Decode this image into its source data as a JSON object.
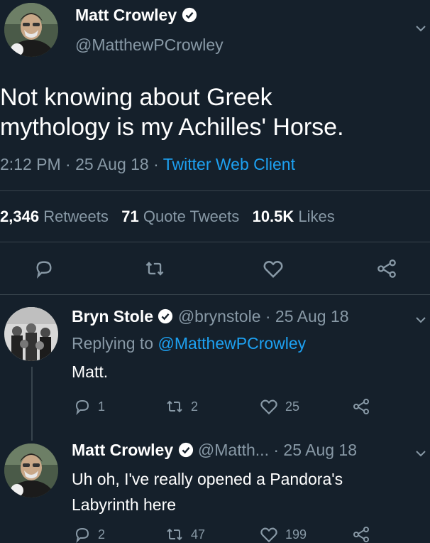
{
  "main_tweet": {
    "author_name": "Matt Crowley",
    "author_handle": "@MatthewPCrowley",
    "text_line1": "Not knowing about Greek",
    "text_line2": "mythology is my Achilles' Horse.",
    "time": "2:12 PM",
    "date": "25 Aug 18",
    "separator": "·",
    "client": "Twitter Web Client",
    "stats": {
      "retweets_count": "2,346",
      "retweets_label": "Retweets",
      "quotes_count": "71",
      "quotes_label": "Quote Tweets",
      "likes_count": "10.5K",
      "likes_label": "Likes"
    }
  },
  "reply_1": {
    "author_name": "Bryn Stole",
    "meta": "@brynstole · 25 Aug 18",
    "replying_prefix": "Replying to",
    "replying_handle": "@MatthewPCrowley",
    "text": "Matt.",
    "replies": "1",
    "retweets": "2",
    "likes": "25"
  },
  "reply_2": {
    "author_name": "Matt Crowley",
    "meta": "@Matth... · 25 Aug 18",
    "text_line1": "Uh oh, I've really opened a Pandora's",
    "text_line2": "Labyrinth here",
    "replies": "2",
    "retweets": "47",
    "likes": "199"
  },
  "colors": {
    "background": "#15202b",
    "text": "#ffffff",
    "muted": "#8899a6",
    "link": "#1da1f2",
    "divider": "#38444d"
  }
}
